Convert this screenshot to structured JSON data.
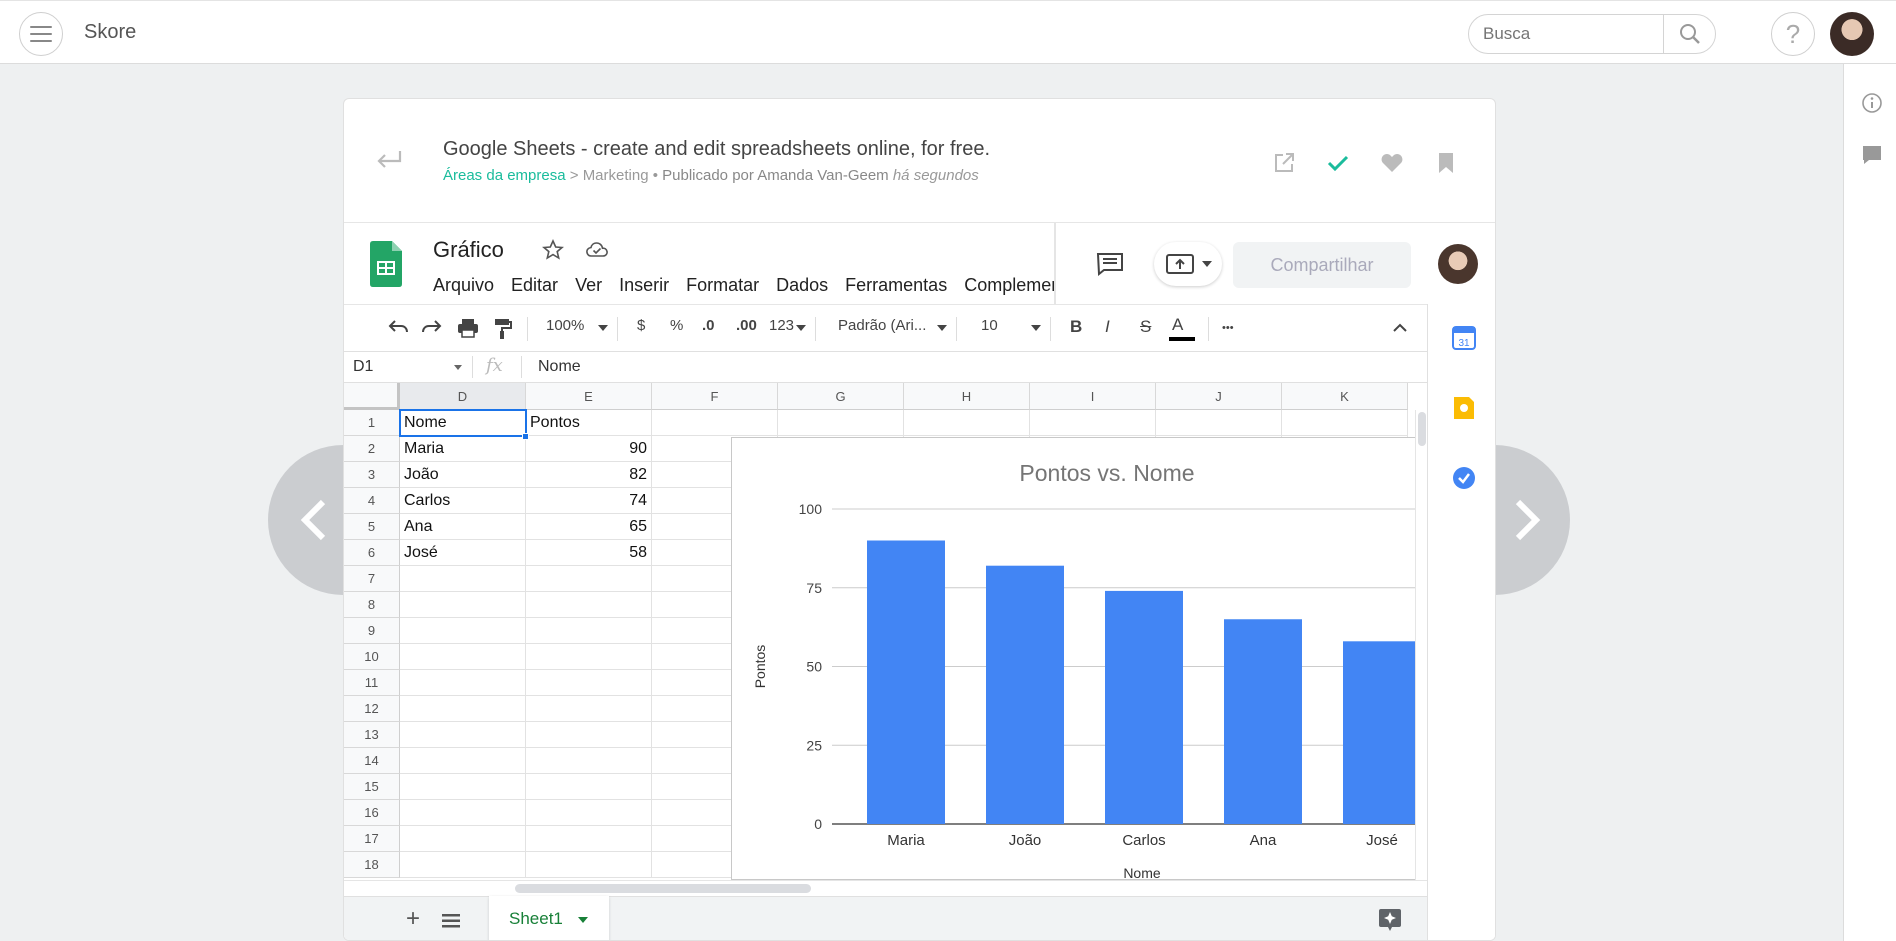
{
  "app": {
    "brand": "Skore"
  },
  "search": {
    "placeholder": "Busca"
  },
  "help": {
    "label": "?"
  },
  "post": {
    "title": "Google Sheets - create and edit spreadsheets online, for free.",
    "category": "Áreas da empresa",
    "sep1": " > ",
    "subcategory": "Marketing",
    "sep2": " • ",
    "published_by": "Publicado por Amanda Van-Geem",
    "when": "há segundos"
  },
  "sheets": {
    "doc_title": "Gráfico",
    "menu": [
      "Arquivo",
      "Editar",
      "Ver",
      "Inserir",
      "Formatar",
      "Dados",
      "Ferramentas",
      "Complementos"
    ],
    "share_label": "Compartilhar",
    "toolbar": {
      "zoom": "100%",
      "currency": "$",
      "percent": "%",
      "dec_less": ".0",
      "dec_more": ".00",
      "format": "123",
      "font": "Padrão (Ari...",
      "size": "10",
      "bold": "B",
      "italic": "I",
      "strike": "S",
      "textcolor": "A",
      "more": "•••"
    },
    "name_box": "D1",
    "fx": "fx",
    "formula": "Nome",
    "columns": [
      "D",
      "E",
      "F",
      "G",
      "H",
      "I",
      "J",
      "K"
    ],
    "rows": [
      "1",
      "2",
      "3",
      "4",
      "5",
      "6",
      "7",
      "8",
      "9",
      "10",
      "11",
      "12",
      "13",
      "14",
      "15",
      "16",
      "17",
      "18"
    ],
    "headers": [
      "Nome",
      "Pontos"
    ],
    "table": [
      {
        "name": "Maria",
        "value": "90"
      },
      {
        "name": "João",
        "value": "82"
      },
      {
        "name": "Carlos",
        "value": "74"
      },
      {
        "name": "Ana",
        "value": "65"
      },
      {
        "name": "José",
        "value": "58"
      }
    ],
    "sheet_tab": "Sheet1"
  },
  "chart_data": {
    "type": "bar",
    "title": "Pontos vs. Nome",
    "xlabel": "Nome",
    "ylabel": "Pontos",
    "categories": [
      "Maria",
      "João",
      "Carlos",
      "Ana",
      "José"
    ],
    "values": [
      90,
      82,
      74,
      65,
      58
    ],
    "ylim": [
      0,
      100
    ],
    "yticks": [
      "0",
      "25",
      "50",
      "75",
      "100"
    ],
    "grid": true,
    "bar_color": "#4285f4"
  },
  "colors": {
    "accent": "#1abc9c",
    "sheets_green": "#188038",
    "selection": "#1a73e8"
  }
}
